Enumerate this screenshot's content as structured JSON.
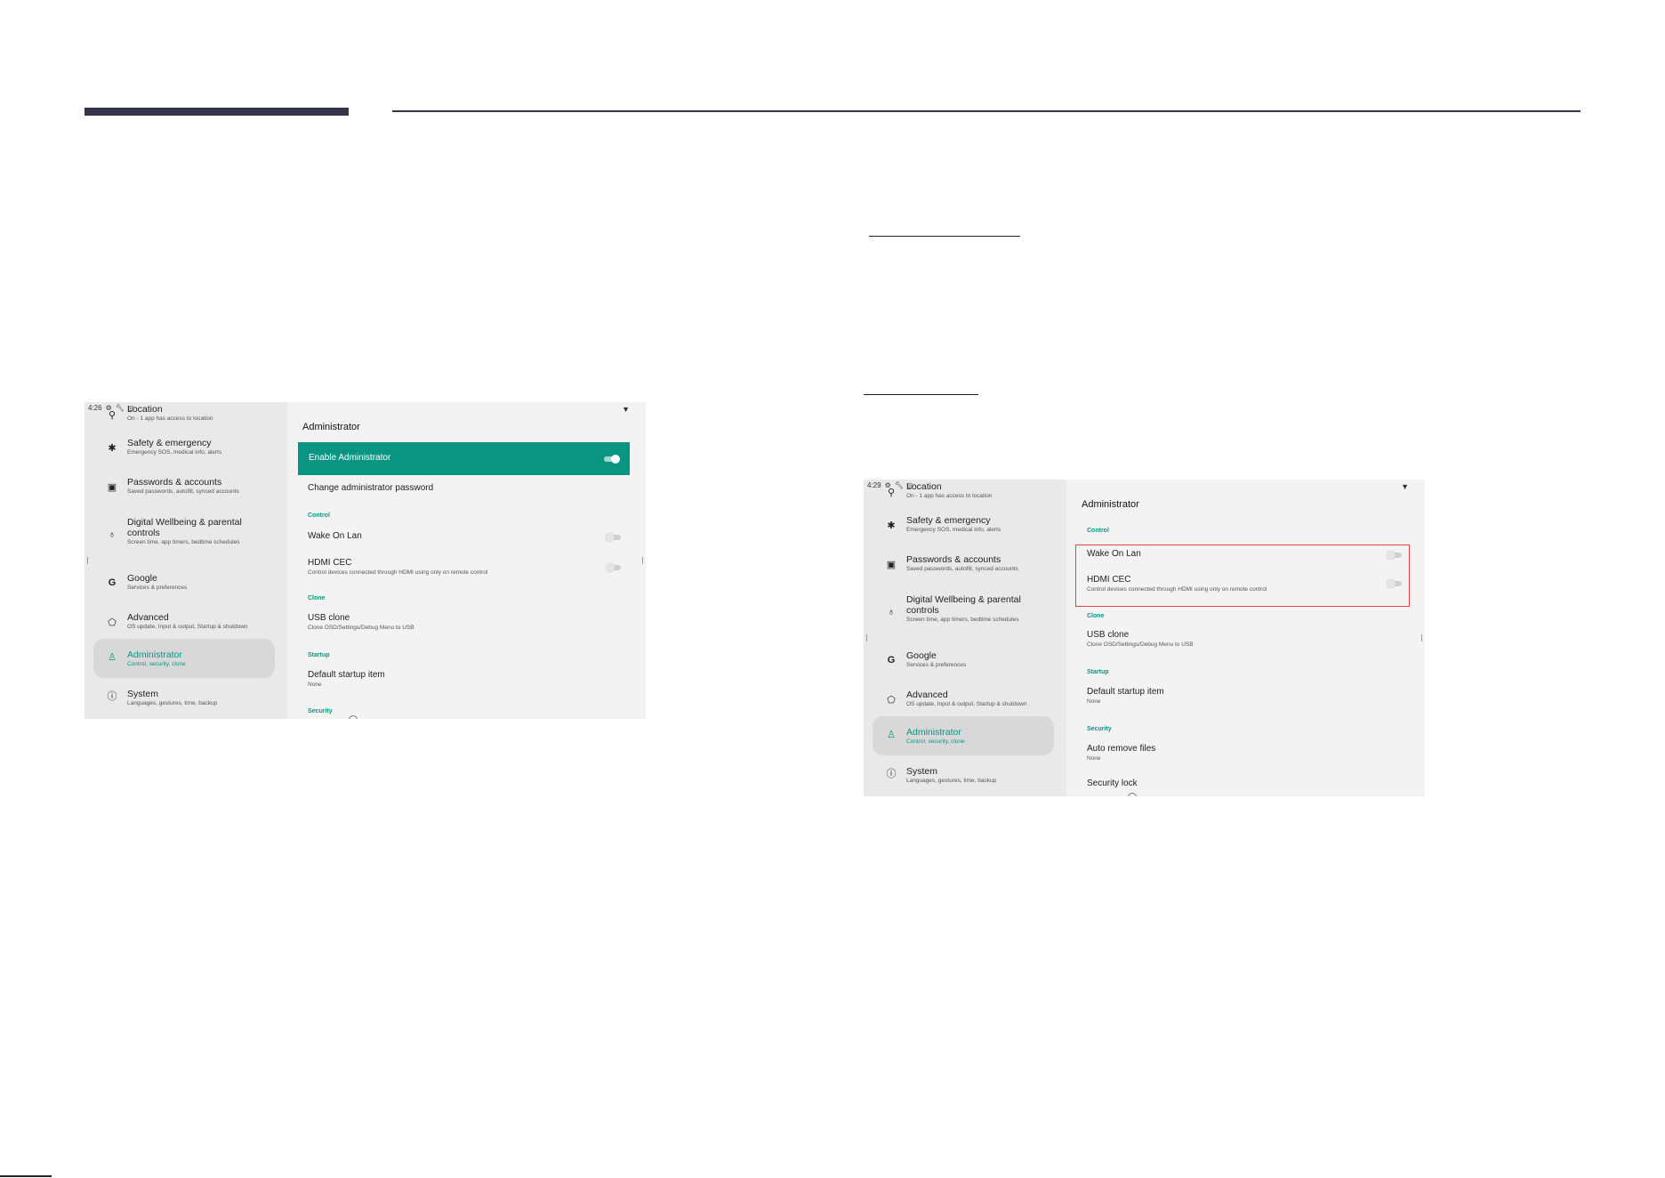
{
  "screenshot_a": {
    "status_time": "4:26",
    "status_icons": [
      "gear-icon",
      "wrench-icon",
      "badge-icon"
    ],
    "wifi_icon": "wifi-icon",
    "nav": [
      {
        "icon": "location-pin-icon",
        "glyph": "⚲",
        "title": "Location",
        "sub": "On - 1 app has access to location"
      },
      {
        "icon": "asterisk-icon",
        "glyph": "✱",
        "title": "Safety & emergency",
        "sub": "Emergency SOS, medical info, alerts"
      },
      {
        "icon": "id-card-icon",
        "glyph": "▣",
        "title": "Passwords & accounts",
        "sub": "Saved passwords, autofill, synced accounts"
      },
      {
        "icon": "wellbeing-icon",
        "glyph": "♁",
        "title": "Digital Wellbeing & parental controls",
        "title_l1": "Digital Wellbeing & parental",
        "title_l2": "controls",
        "sub": "Screen time, app timers, bedtime schedules"
      },
      {
        "icon": "google-icon",
        "glyph": "G",
        "title": "Google",
        "sub": "Services & preferences"
      },
      {
        "icon": "advanced-icon",
        "glyph": "⬠",
        "title": "Advanced",
        "sub": "OS update, Input & output, Startup & shutdown"
      },
      {
        "icon": "administrator-icon",
        "glyph": "♙",
        "title": "Administrator",
        "sub": "Control, security, clone",
        "active": true
      },
      {
        "icon": "info-icon",
        "glyph": "ⓘ",
        "title": "System",
        "sub": "Languages, gestures, time, backup"
      }
    ],
    "page_title": "Administrator",
    "enable_label": "Enable Administrator",
    "enable_on": true,
    "change_password": "Change administrator password",
    "sections": {
      "control": "Control",
      "clone": "Clone",
      "startup": "Startup",
      "security": "Security"
    },
    "wake_on_lan": "Wake On Lan",
    "hdmi_cec": "HDMI CEC",
    "hdmi_cec_sub": "Control devices connected through HDMI using only on remote control",
    "usb_clone": "USB clone",
    "usb_clone_sub": "Clone OSD/Settings/Debug Menu to USB",
    "default_startup": "Default startup item",
    "default_startup_sub": "None"
  },
  "screenshot_b": {
    "status_time": "4:29",
    "page_title": "Administrator",
    "sections": {
      "control": "Control",
      "clone": "Clone",
      "startup": "Startup",
      "security": "Security"
    },
    "wake_on_lan": "Wake On Lan",
    "hdmi_cec": "HDMI CEC",
    "hdmi_cec_sub": "Control devices connected through HDMI using only on remote control",
    "usb_clone": "USB clone",
    "usb_clone_sub": "Clone OSD/Settings/Debug Menu to USB",
    "default_startup": "Default startup item",
    "default_startup_sub": "None",
    "auto_remove": "Auto remove files",
    "auto_remove_sub": "None",
    "security_lock": "Security lock",
    "highlight_color": "#e64545"
  },
  "colors": {
    "accent": "#0a9583",
    "header_bar": "#34344a"
  }
}
